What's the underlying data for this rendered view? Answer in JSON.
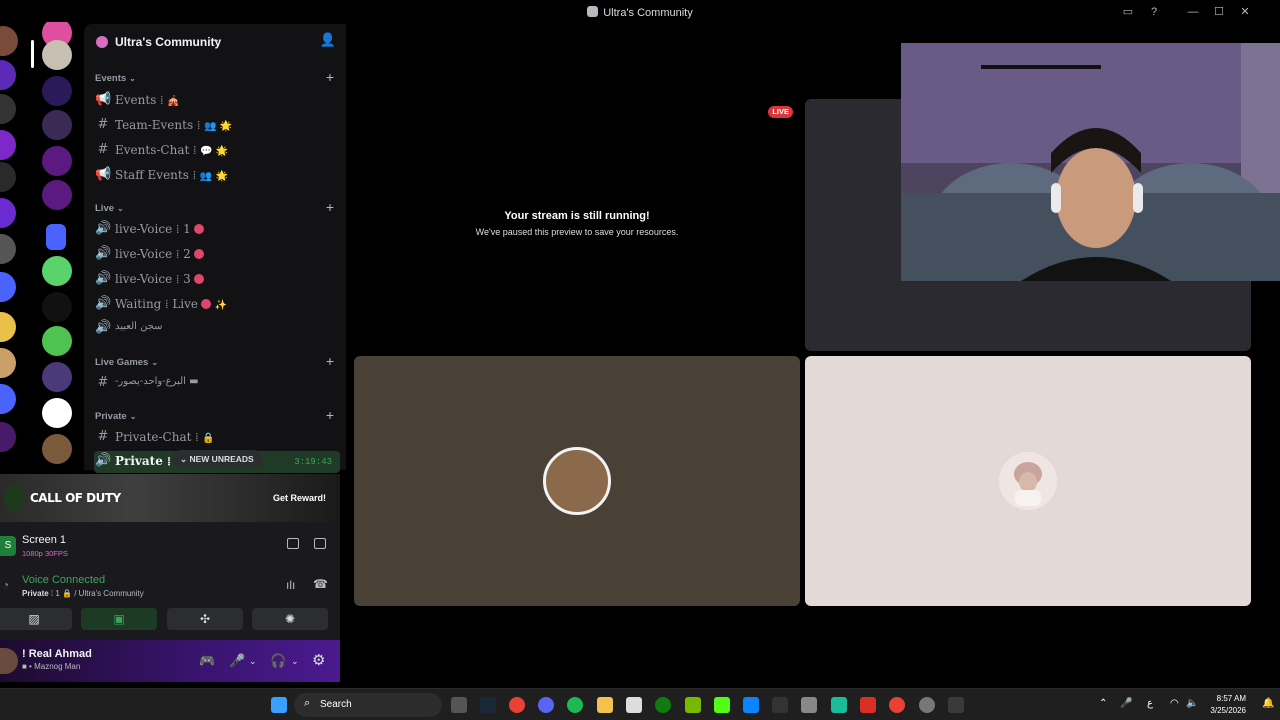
{
  "window": {
    "title": "Ultra's Community"
  },
  "server": {
    "name": "Ultra's Community"
  },
  "categories": {
    "events": {
      "label": "Events"
    },
    "live": {
      "label": "Live"
    },
    "live_games": {
      "label": "Live Games"
    },
    "private": {
      "label": "Private"
    }
  },
  "channels": {
    "events": {
      "name": "Events",
      "tail": "🎪"
    },
    "team_events": {
      "name": "Team-Events",
      "tail": "👥 🌟"
    },
    "events_chat": {
      "name": "Events-Chat",
      "tail": "💬 🌟"
    },
    "staff_events": {
      "name": "Staff Events",
      "tail": "👥 🌟"
    },
    "live_voice_1": {
      "name": "live-Voice",
      "num": "1"
    },
    "live_voice_2": {
      "name": "live-Voice",
      "num": "2"
    },
    "live_voice_3": {
      "name": "live-Voice",
      "num": "3"
    },
    "waiting_live": {
      "name": "Waiting",
      "suffix": "Live"
    },
    "prison": {
      "name": "سجن العبيد"
    },
    "live_game_text": {
      "name": "-البرع-واحد-يصور"
    },
    "private_chat": {
      "name": "Private-Chat"
    },
    "private_voice": {
      "name": "Private",
      "timer": "3:19:43"
    }
  },
  "new_unreads": "NEW UNREADS",
  "promo": {
    "brand": "CALL OF DUTY",
    "button": "Get Reward!"
  },
  "screen_share": {
    "title": "Screen 1",
    "subtitle": "1080p 30FPS"
  },
  "voice": {
    "status": "Voice Connected",
    "channel": "Private",
    "server": "/ Ultra's Community"
  },
  "user": {
    "name": "! Real Ahmad",
    "status": "Maznog Man"
  },
  "stage": {
    "live_badge": "LIVE",
    "stream_msg": "Your stream is still running!",
    "stream_sub": "We've paused this preview to save your resources."
  },
  "taskbar": {
    "search": "Search",
    "time": "8:57 AM",
    "date": "3/25/2026"
  },
  "colors": {
    "accent_green": "#3ba55d",
    "live_red": "#da373c",
    "brand_purple": "#4b1a8f"
  }
}
